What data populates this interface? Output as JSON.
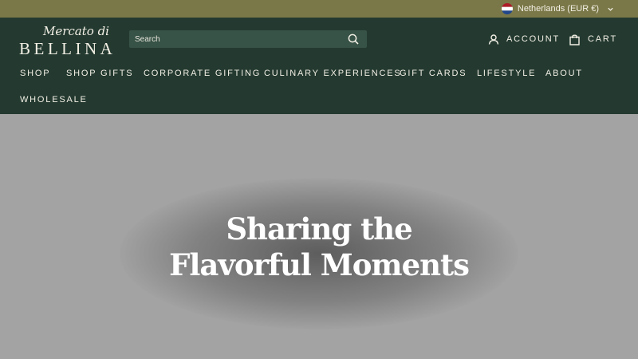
{
  "topbar": {
    "locale_label": "Netherlands (EUR €)",
    "flag_colors": [
      "#ae1c28",
      "#ffffff",
      "#21468b"
    ]
  },
  "logo": {
    "script": "Mercato di",
    "word": "BELLINA"
  },
  "search": {
    "placeholder": "Search"
  },
  "account": {
    "label": "ACCOUNT"
  },
  "cart": {
    "label": "CART"
  },
  "nav": {
    "items": [
      {
        "label": "SHOP"
      },
      {
        "label": "SHOP GIFTS"
      },
      {
        "label": "CORPORATE GIFTING"
      },
      {
        "label": "CULINARY EXPERIENCES"
      },
      {
        "label": "GIFT CARDS"
      },
      {
        "label": "LIFESTYLE"
      },
      {
        "label": "ABOUT"
      },
      {
        "label": "WHOLESALE"
      }
    ]
  },
  "hero": {
    "title_line1": "Sharing the",
    "title_line2": "Flavorful Moments"
  },
  "colors": {
    "topbar_bg": "#7a7848",
    "header_bg": "#243a31",
    "text_light": "#f2efe4",
    "hero_bg": "#a3a3a3"
  }
}
